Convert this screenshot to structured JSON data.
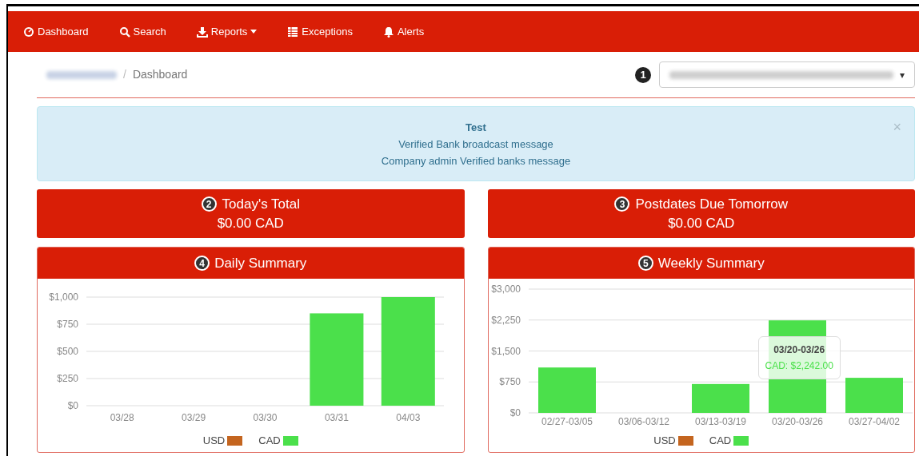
{
  "nav": [
    {
      "label": "Dashboard",
      "caret": false
    },
    {
      "label": "Search",
      "caret": false
    },
    {
      "label": "Reports",
      "caret": true
    },
    {
      "label": "Exceptions",
      "caret": false
    },
    {
      "label": "Alerts",
      "caret": false
    }
  ],
  "breadcrumb": {
    "separator": "/",
    "current": "Dashboard"
  },
  "company_select": {
    "badge": "1",
    "caret": "▾"
  },
  "alert": {
    "title": "Test",
    "lines": [
      "Verified Bank broadcast message",
      "Company admin Verified banks message"
    ],
    "close": "×"
  },
  "totals": [
    {
      "badge": "2",
      "title": "Today's Total",
      "value": "$0.00 CAD"
    },
    {
      "badge": "3",
      "title": "Postdates Due Tomorrow",
      "value": "$0.00 CAD"
    }
  ],
  "summaries": [
    {
      "badge": "4",
      "title": "Daily Summary",
      "chart_data": {
        "type": "bar",
        "grid": true,
        "categories": [
          "03/28",
          "03/29",
          "03/30",
          "03/31",
          "04/03"
        ],
        "series": [
          {
            "name": "USD",
            "color": "#c4651f",
            "values": [
              0,
              0,
              0,
              0,
              0
            ]
          },
          {
            "name": "CAD",
            "color": "#4be04b",
            "values": [
              0,
              0,
              0,
              850,
              1000
            ]
          }
        ],
        "ylim": [
          0,
          1000
        ],
        "yticks": [
          {
            "value": 0,
            "label": "$0"
          },
          {
            "value": 250,
            "label": "$250"
          },
          {
            "value": 500,
            "label": "$500"
          },
          {
            "value": 750,
            "label": "$750"
          },
          {
            "value": 1000,
            "label": "$1,000"
          }
        ]
      }
    },
    {
      "badge": "5",
      "title": "Weekly Summary",
      "tooltip": {
        "title": "03/20-03/26",
        "text": "CAD: $2,242.00"
      },
      "chart_data": {
        "type": "bar",
        "grid": true,
        "categories": [
          "02/27-03/05",
          "03/06-03/12",
          "03/13-03/19",
          "03/20-03/26",
          "03/27-04/02"
        ],
        "series": [
          {
            "name": "USD",
            "color": "#c4651f",
            "values": [
              0,
              0,
              0,
              0,
              0
            ]
          },
          {
            "name": "CAD",
            "color": "#4be04b",
            "values": [
              1100,
              0,
              700,
              2242,
              850
            ]
          }
        ],
        "ylim": [
          0,
          3000
        ],
        "yticks": [
          {
            "value": 0,
            "label": "$0"
          },
          {
            "value": 750,
            "label": "$750"
          },
          {
            "value": 1500,
            "label": "$1,500"
          },
          {
            "value": 2250,
            "label": "$2,250"
          },
          {
            "value": 3000,
            "label": "$3,000"
          }
        ]
      }
    }
  ]
}
